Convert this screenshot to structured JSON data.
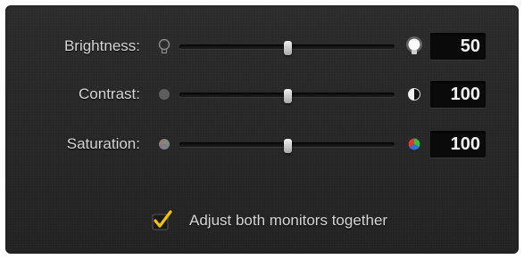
{
  "sliders": [
    {
      "label": "Brightness:",
      "value": "50",
      "level": 0.5,
      "min_icon": "dim-bulb-icon",
      "max_icon": "bright-bulb-icon"
    },
    {
      "label": "Contrast:",
      "value": "100",
      "level": 0.5,
      "min_icon": "low-contrast-icon",
      "max_icon": "high-contrast-icon"
    },
    {
      "label": "Saturation:",
      "value": "100",
      "level": 0.5,
      "min_icon": "low-saturation-icon",
      "max_icon": "high-saturation-icon"
    }
  ],
  "checkbox": {
    "label": "Adjust both monitors together",
    "checked": true
  },
  "colors": {
    "panel": "#262626",
    "text": "#d6d6d6",
    "value_box": "#0a0a0a",
    "checkmark": "#f2c300"
  }
}
